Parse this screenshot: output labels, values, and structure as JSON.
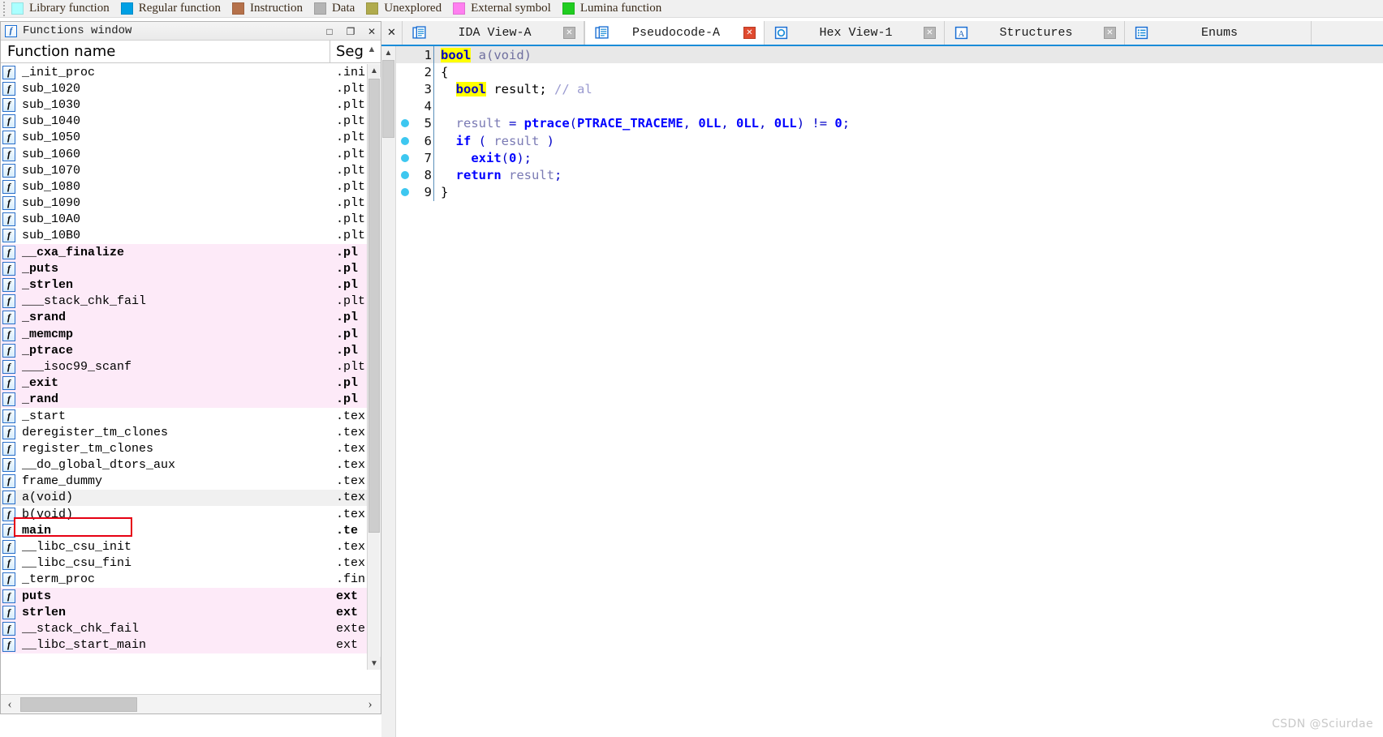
{
  "legend": {
    "items": [
      {
        "label": "Library function",
        "color": "#aaffff",
        "icon": "color-swatch"
      },
      {
        "label": "Regular function",
        "color": "#00a0e4",
        "icon": "color-swatch"
      },
      {
        "label": "Instruction",
        "color": "#b5714a",
        "icon": "color-swatch"
      },
      {
        "label": "Data",
        "color": "#b4b4b4",
        "icon": "color-swatch"
      },
      {
        "label": "Unexplored",
        "color": "#b0ab4d",
        "icon": "color-swatch"
      },
      {
        "label": "External symbol",
        "color": "#ff7ff0",
        "icon": "color-swatch"
      },
      {
        "label": "Lumina function",
        "color": "#21cd21",
        "icon": "color-swatch"
      }
    ]
  },
  "functions_window": {
    "title": "Functions window",
    "title_icon": "function-icon",
    "title_buttons": [
      {
        "name": "restore-button",
        "glyph": "□"
      },
      {
        "name": "maximize-button",
        "glyph": "❐"
      },
      {
        "name": "close-button",
        "glyph": "✕"
      }
    ],
    "columns": {
      "name": "Function name",
      "segment": "Seg"
    },
    "rows": [
      {
        "name": "_init_proc",
        "seg": ".ini",
        "pink": false,
        "bold": false,
        "selected": false
      },
      {
        "name": "sub_1020",
        "seg": ".plt",
        "pink": false,
        "bold": false,
        "selected": false
      },
      {
        "name": "sub_1030",
        "seg": ".plt",
        "pink": false,
        "bold": false,
        "selected": false
      },
      {
        "name": "sub_1040",
        "seg": ".plt",
        "pink": false,
        "bold": false,
        "selected": false
      },
      {
        "name": "sub_1050",
        "seg": ".plt",
        "pink": false,
        "bold": false,
        "selected": false
      },
      {
        "name": "sub_1060",
        "seg": ".plt",
        "pink": false,
        "bold": false,
        "selected": false
      },
      {
        "name": "sub_1070",
        "seg": ".plt",
        "pink": false,
        "bold": false,
        "selected": false
      },
      {
        "name": "sub_1080",
        "seg": ".plt",
        "pink": false,
        "bold": false,
        "selected": false
      },
      {
        "name": "sub_1090",
        "seg": ".plt",
        "pink": false,
        "bold": false,
        "selected": false
      },
      {
        "name": "sub_10A0",
        "seg": ".plt",
        "pink": false,
        "bold": false,
        "selected": false
      },
      {
        "name": "sub_10B0",
        "seg": ".plt",
        "pink": false,
        "bold": false,
        "selected": false
      },
      {
        "name": "__cxa_finalize",
        "seg": ".pl",
        "pink": true,
        "bold": true,
        "selected": false
      },
      {
        "name": "_puts",
        "seg": ".pl",
        "pink": true,
        "bold": true,
        "selected": false
      },
      {
        "name": "_strlen",
        "seg": ".pl",
        "pink": true,
        "bold": true,
        "selected": false
      },
      {
        "name": "___stack_chk_fail",
        "seg": ".plt",
        "pink": true,
        "bold": false,
        "selected": false
      },
      {
        "name": "_srand",
        "seg": ".pl",
        "pink": true,
        "bold": true,
        "selected": false
      },
      {
        "name": "_memcmp",
        "seg": ".pl",
        "pink": true,
        "bold": true,
        "selected": false
      },
      {
        "name": "_ptrace",
        "seg": ".pl",
        "pink": true,
        "bold": true,
        "selected": false
      },
      {
        "name": "___isoc99_scanf",
        "seg": ".plt",
        "pink": true,
        "bold": false,
        "selected": false
      },
      {
        "name": "_exit",
        "seg": ".pl",
        "pink": true,
        "bold": true,
        "selected": false
      },
      {
        "name": "_rand",
        "seg": ".pl",
        "pink": true,
        "bold": true,
        "selected": false
      },
      {
        "name": "_start",
        "seg": ".tex",
        "pink": false,
        "bold": false,
        "selected": false
      },
      {
        "name": "deregister_tm_clones",
        "seg": ".tex",
        "pink": false,
        "bold": false,
        "selected": false
      },
      {
        "name": "register_tm_clones",
        "seg": ".tex",
        "pink": false,
        "bold": false,
        "selected": false
      },
      {
        "name": "__do_global_dtors_aux",
        "seg": ".tex",
        "pink": false,
        "bold": false,
        "selected": false
      },
      {
        "name": "frame_dummy",
        "seg": ".tex",
        "pink": false,
        "bold": false,
        "selected": false
      },
      {
        "name": "a(void)",
        "seg": ".tex",
        "pink": false,
        "bold": false,
        "selected": true
      },
      {
        "name": "b(void)",
        "seg": ".tex",
        "pink": false,
        "bold": false,
        "selected": false
      },
      {
        "name": "main",
        "seg": ".te",
        "pink": false,
        "bold": true,
        "selected": false
      },
      {
        "name": "__libc_csu_init",
        "seg": ".tex",
        "pink": false,
        "bold": false,
        "selected": false
      },
      {
        "name": "__libc_csu_fini",
        "seg": ".tex",
        "pink": false,
        "bold": false,
        "selected": false
      },
      {
        "name": "_term_proc",
        "seg": ".fin",
        "pink": false,
        "bold": false,
        "selected": false
      },
      {
        "name": "puts",
        "seg": "ext",
        "pink": true,
        "bold": true,
        "selected": false
      },
      {
        "name": "strlen",
        "seg": "ext",
        "pink": true,
        "bold": true,
        "selected": false
      },
      {
        "name": "__stack_chk_fail",
        "seg": "exte",
        "pink": true,
        "bold": false,
        "selected": false
      },
      {
        "name": "__libc_start_main",
        "seg": "ext",
        "pink": true,
        "bold": false,
        "selected": false
      }
    ],
    "annotation": {
      "name": "red-highlight-box",
      "target_row": "a(void)",
      "color": "#e60012"
    }
  },
  "tabs": {
    "close_all_glyph": "✕",
    "items": [
      {
        "label": "IDA View-A",
        "icon": "document-icon",
        "active": false,
        "close_glyph": "✕"
      },
      {
        "label": "Pseudocode-A",
        "icon": "document-icon",
        "active": true,
        "close_glyph": "✕"
      },
      {
        "label": "Hex View-1",
        "icon": "hex-icon",
        "active": false,
        "close_glyph": "✕"
      },
      {
        "label": "Structures",
        "icon": "structures-icon",
        "active": false,
        "close_glyph": "✕"
      },
      {
        "label": "Enums",
        "icon": "enums-icon",
        "active": false,
        "close_glyph": ""
      }
    ]
  },
  "pseudocode": {
    "lines": [
      {
        "n": "1",
        "bp": false,
        "current": true,
        "tokens": [
          {
            "t": "bool",
            "c": "hl"
          },
          {
            "t": " ",
            "c": "plain"
          },
          {
            "t": "a(void)",
            "c": "fnm"
          }
        ]
      },
      {
        "n": "2",
        "bp": false,
        "current": false,
        "tokens": [
          {
            "t": "{",
            "c": "plain"
          }
        ]
      },
      {
        "n": "3",
        "bp": false,
        "current": false,
        "tokens": [
          {
            "t": "  ",
            "c": "plain"
          },
          {
            "t": "bool",
            "c": "hl"
          },
          {
            "t": " result; ",
            "c": "plain"
          },
          {
            "t": "// al",
            "c": "cmt"
          }
        ]
      },
      {
        "n": "4",
        "bp": false,
        "current": false,
        "tokens": [
          {
            "t": "",
            "c": "plain"
          }
        ]
      },
      {
        "n": "5",
        "bp": true,
        "current": false,
        "tokens": [
          {
            "t": "  ",
            "c": "plain"
          },
          {
            "t": "result",
            "c": "var"
          },
          {
            "t": " = ",
            "c": "punc"
          },
          {
            "t": "ptrace",
            "c": "kw"
          },
          {
            "t": "(",
            "c": "punc"
          },
          {
            "t": "PTRACE_TRACEME",
            "c": "kw"
          },
          {
            "t": ", ",
            "c": "punc"
          },
          {
            "t": "0LL",
            "c": "num"
          },
          {
            "t": ", ",
            "c": "punc"
          },
          {
            "t": "0LL",
            "c": "num"
          },
          {
            "t": ", ",
            "c": "punc"
          },
          {
            "t": "0LL",
            "c": "num"
          },
          {
            "t": ")",
            "c": "punc"
          },
          {
            "t": " != ",
            "c": "punc"
          },
          {
            "t": "0",
            "c": "num"
          },
          {
            "t": ";",
            "c": "punc"
          }
        ]
      },
      {
        "n": "6",
        "bp": true,
        "current": false,
        "tokens": [
          {
            "t": "  ",
            "c": "plain"
          },
          {
            "t": "if",
            "c": "kw"
          },
          {
            "t": " ( ",
            "c": "punc"
          },
          {
            "t": "result",
            "c": "var"
          },
          {
            "t": " )",
            "c": "punc"
          }
        ]
      },
      {
        "n": "7",
        "bp": true,
        "current": false,
        "tokens": [
          {
            "t": "    ",
            "c": "plain"
          },
          {
            "t": "exit",
            "c": "kw"
          },
          {
            "t": "(",
            "c": "punc"
          },
          {
            "t": "0",
            "c": "num"
          },
          {
            "t": ");",
            "c": "punc"
          }
        ]
      },
      {
        "n": "8",
        "bp": true,
        "current": false,
        "tokens": [
          {
            "t": "  ",
            "c": "plain"
          },
          {
            "t": "return",
            "c": "kw"
          },
          {
            "t": " ",
            "c": "plain"
          },
          {
            "t": "result",
            "c": "var"
          },
          {
            "t": ";",
            "c": "punc"
          }
        ]
      },
      {
        "n": "9",
        "bp": true,
        "current": false,
        "tokens": [
          {
            "t": "}",
            "c": "plain"
          }
        ]
      }
    ]
  },
  "watermark": "CSDN @Sciurdae"
}
